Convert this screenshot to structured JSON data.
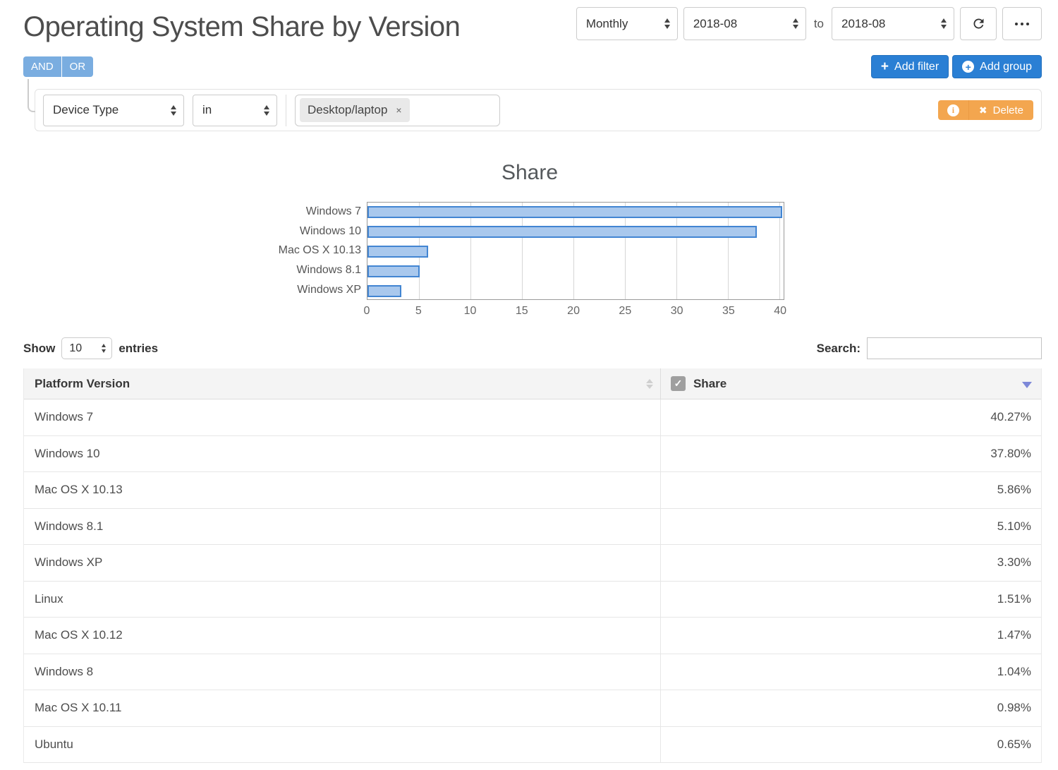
{
  "page": {
    "title": "Operating System Share by Version"
  },
  "toolbar": {
    "period": "Monthly",
    "date_from": "2018-08",
    "to_label": "to",
    "date_to": "2018-08"
  },
  "filter_bar": {
    "and_label": "AND",
    "or_label": "OR",
    "add_filter_label": "Add filter",
    "add_group_label": "Add group"
  },
  "filter_row": {
    "field": "Device Type",
    "operator": "in",
    "tag": "Desktop/laptop",
    "delete_label": "Delete"
  },
  "icons": {
    "plus": "+",
    "circle_plus": "+",
    "info": "i",
    "delete_x": "✖",
    "tag_remove": "×",
    "checkmark": "✓"
  },
  "chart_data": {
    "type": "bar",
    "orientation": "horizontal",
    "title": "Share",
    "categories": [
      "Windows 7",
      "Windows 10",
      "Mac OS X 10.13",
      "Windows 8.1",
      "Windows XP"
    ],
    "values": [
      40.27,
      37.8,
      5.86,
      5.1,
      3.3
    ],
    "xticks": [
      0,
      5,
      10,
      15,
      20,
      25,
      30,
      35,
      40
    ],
    "xlim": [
      0,
      40.4
    ],
    "grid": true,
    "legend": false,
    "bar_fill": "#a9c8ed",
    "bar_border": "#4285d2"
  },
  "table_controls": {
    "show_label": "Show",
    "page_size": "10",
    "entries_label": "entries",
    "search_label": "Search:",
    "search_value": ""
  },
  "table": {
    "columns": [
      "Platform Version",
      "Share"
    ],
    "rows": [
      {
        "platform": "Windows 7",
        "share": "40.27%"
      },
      {
        "platform": "Windows 10",
        "share": "37.80%"
      },
      {
        "platform": "Mac OS X 10.13",
        "share": "5.86%"
      },
      {
        "platform": "Windows 8.1",
        "share": "5.10%"
      },
      {
        "platform": "Windows XP",
        "share": "3.30%"
      },
      {
        "platform": "Linux",
        "share": "1.51%"
      },
      {
        "platform": "Mac OS X 10.12",
        "share": "1.47%"
      },
      {
        "platform": "Windows 8",
        "share": "1.04%"
      },
      {
        "platform": "Mac OS X 10.11",
        "share": "0.98%"
      },
      {
        "platform": "Ubuntu",
        "share": "0.65%"
      }
    ]
  },
  "colors": {
    "accent_blue": "#2a7fd4",
    "soft_blue": "#7aade0",
    "warning_orange": "#f3a64f",
    "sort_active": "#7d88d8"
  }
}
